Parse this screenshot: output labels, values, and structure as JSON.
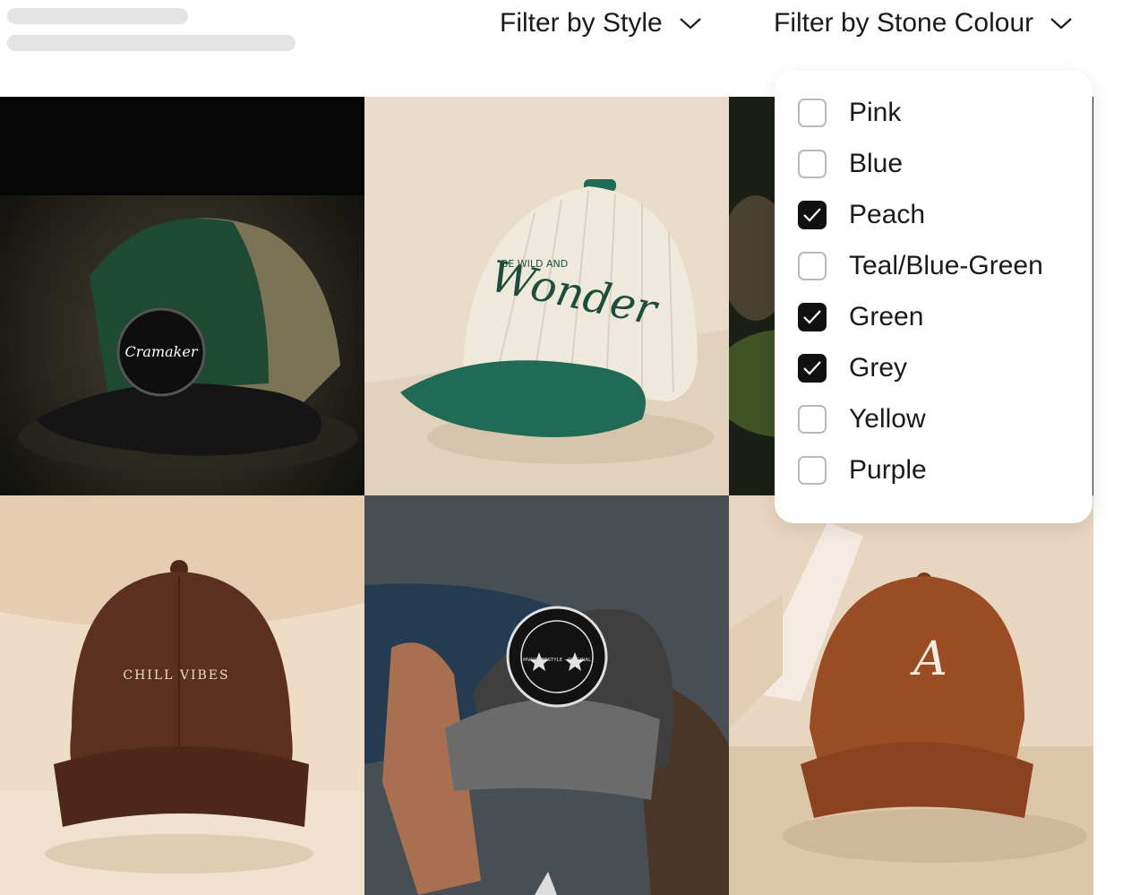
{
  "filters": {
    "style_label": "Filter by Style",
    "colour_label": "Filter by Stone Colour"
  },
  "colour_options": [
    {
      "label": "Pink",
      "checked": false
    },
    {
      "label": "Blue",
      "checked": false
    },
    {
      "label": "Peach",
      "checked": true
    },
    {
      "label": "Teal/Blue-Green",
      "checked": false
    },
    {
      "label": "Green",
      "checked": true
    },
    {
      "label": "Grey",
      "checked": true
    },
    {
      "label": "Yellow",
      "checked": false
    },
    {
      "label": "Purple",
      "checked": false
    }
  ],
  "products": [
    {
      "name": "green-trucker-cap",
      "patch_text": "Cramaker"
    },
    {
      "name": "cream-corduroy-cap",
      "embroidery_small": "BE WILD AND",
      "embroidery": "Wonder"
    },
    {
      "name": "cap-tile-3"
    },
    {
      "name": "brown-chill-vibes-cap",
      "embroidery": "CHILL VIBES"
    },
    {
      "name": "grey-patch-cap",
      "patch_text": "MVCCLIFESTYLE · ORIGINAL"
    },
    {
      "name": "brown-a-cap",
      "embroidery": "A"
    }
  ],
  "colors": {
    "checked": "#111111",
    "unchecked_border": "#b9b9b9"
  }
}
